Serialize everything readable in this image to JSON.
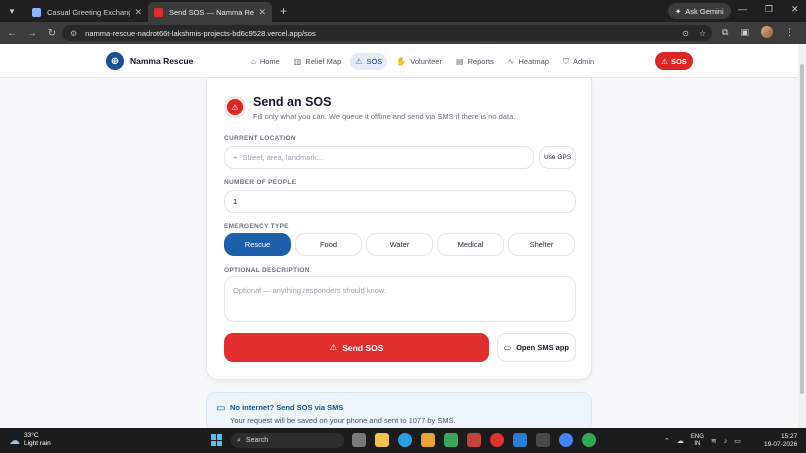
{
  "browser": {
    "tabs": [
      {
        "title": "Casual Greeting Exchange - Ge",
        "active": false,
        "favicon_color": "#8ab4f8"
      },
      {
        "title": "Send SOS — Namma Rescue",
        "active": true,
        "favicon_color": "#e02d2d"
      }
    ],
    "gemini_label": "Ask Gemini",
    "url": "namma-rescue-nadrot66t-lakshmis-projects-bd6c9528.vercel.app/sos"
  },
  "navbar": {
    "brand": "Namma Rescue",
    "links": [
      {
        "label": "Home",
        "icon": "home-icon",
        "glyph": "⌂"
      },
      {
        "label": "Relief Map",
        "icon": "map-icon",
        "glyph": "▥"
      },
      {
        "label": "SOS",
        "icon": "siren-icon",
        "glyph": "⚠",
        "active": true
      },
      {
        "label": "Volunteer",
        "icon": "handshake-icon",
        "glyph": "✋"
      },
      {
        "label": "Reports",
        "icon": "document-icon",
        "glyph": "▤"
      },
      {
        "label": "Heatmap",
        "icon": "activity-icon",
        "glyph": "∿"
      },
      {
        "label": "Admin",
        "icon": "shield-icon",
        "glyph": "⛉"
      }
    ],
    "sos_button": "SOS"
  },
  "form": {
    "title": "Send an SOS",
    "subtitle": "Fill only what you can. We queue it offline and send via SMS if there is no data.",
    "location_label": "CURRENT LOCATION",
    "location_placeholder": "Street, area, landmark...",
    "gps_button": "Use GPS",
    "people_label": "NUMBER OF PEOPLE",
    "people_value": "1",
    "type_label": "EMERGENCY TYPE",
    "types": [
      "Rescue",
      "Food",
      "Water",
      "Medical",
      "Shelter"
    ],
    "selected_type": "Rescue",
    "description_label": "OPTIONAL DESCRIPTION",
    "description_placeholder": "Optional — anything responders should know.",
    "send_button": "Send SOS",
    "sms_button": "Open SMS app"
  },
  "info": {
    "title": "No internet? Send SOS via SMS",
    "text": "Your request will be saved on your phone and sent to 1077 by SMS."
  },
  "taskbar": {
    "temp": "33°C",
    "weather": "Light rain",
    "search": "Search",
    "lang1": "ENG",
    "lang2": "IN",
    "time": "15:27",
    "date": "19-07-2026"
  },
  "colors": {
    "accent_blue": "#1d5fa8",
    "sos_red": "#e02d2d"
  }
}
